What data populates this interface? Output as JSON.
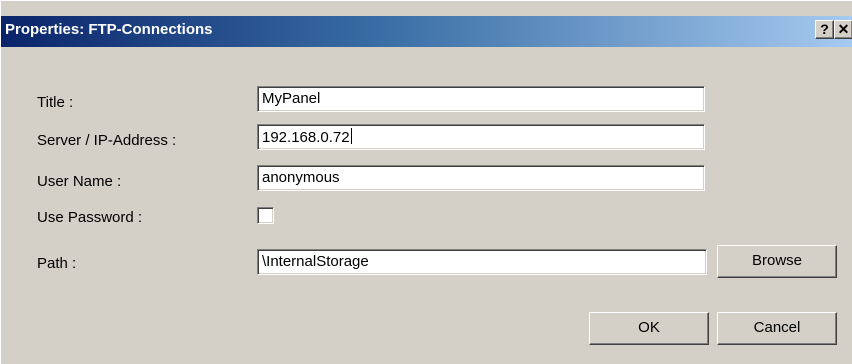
{
  "window": {
    "title": "Properties: FTP-Connections",
    "help_glyph": "?",
    "close_glyph": "✕"
  },
  "form": {
    "title_label": "Title :",
    "title_value": "MyPanel",
    "server_label": "Server / IP-Address :",
    "server_value": "192.168.0.72",
    "user_label": "User Name :",
    "user_value": "anonymous",
    "password_label": "Use Password :",
    "use_password_checked": false,
    "path_label": "Path :",
    "path_value": "\\InternalStorage"
  },
  "buttons": {
    "browse": "Browse",
    "ok": "OK",
    "cancel": "Cancel"
  },
  "colors": {
    "titlebar_start": "#0a246a",
    "titlebar_end": "#a6caf0",
    "dialog_face": "#d4d0c8"
  }
}
